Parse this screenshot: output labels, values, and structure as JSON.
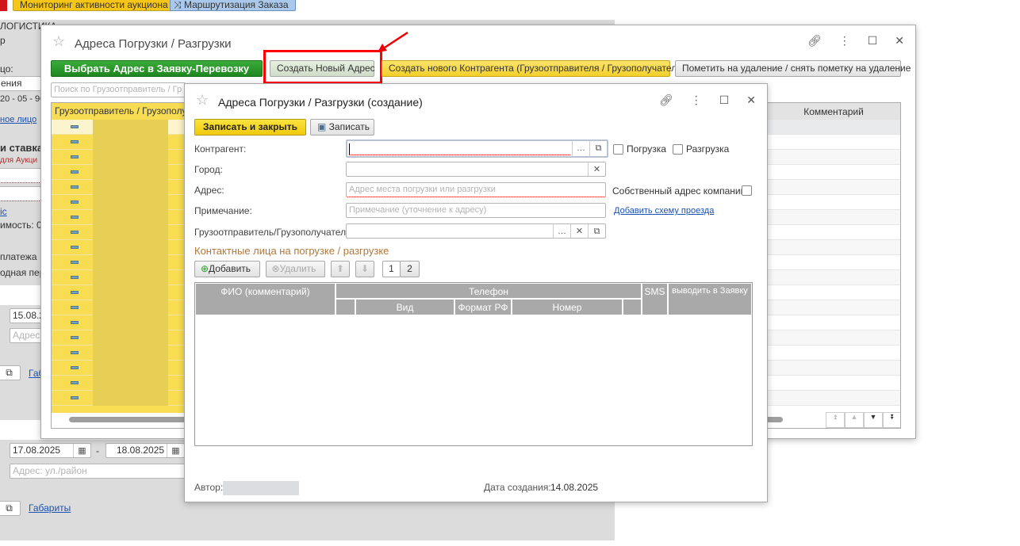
{
  "top_toolbar": {
    "monitoring": "Мониторинг активности аукциона",
    "routing": "Маршрутизация Заказа",
    "routing_icon": "shuffle-icon"
  },
  "background": {
    "section_title": "ЛОГИСТИКА",
    "line1": "р",
    "contact_label": "цо:",
    "field1": "ения",
    "phone": "20 - 05 - 90",
    "contact_link": "ное лицо",
    "rate_title": "и ставка",
    "rate_sub": "для Аукци",
    "link_ic": "ic",
    "cost": "имость: 0",
    "payment": "платежа",
    "transfer": "одная пер",
    "date1": "15.08.2",
    "addr1_placeholder": "Адрес:",
    "gab1": "Габ",
    "date_from": "17.08.2025",
    "date_sep": "-",
    "date_to": "18.08.2025",
    "addr2_placeholder": "Адрес: ул./район",
    "gab2": "Габариты"
  },
  "list_window": {
    "title": "Адреса Погрузки / Разгрузки",
    "buttons": {
      "select": "Выбрать Адрес в Заявку-Перевозку",
      "create": "Создать Новый Адрес",
      "create_contractor": "Создать нового Контрагента (Грузоотправителя / Грузополучателя)",
      "mark_delete": "Пометить на удаление / снять пометку на удаление"
    },
    "search_placeholder": "Поиск по Грузоотправитель / Гр",
    "columns": {
      "shipper": "Грузоотправитель / Грузополуч",
      "comment": "Комментарий"
    }
  },
  "create_dialog": {
    "title": "Адреса Погрузки / Разгрузки (создание)",
    "save_close": "Записать и закрыть",
    "save": "Записать",
    "labels": {
      "contractor": "Контрагент:",
      "city": "Город:",
      "address": "Адрес:",
      "note": "Примечание:",
      "shipper": "Грузоотправитель/Грузополучатель:"
    },
    "address_placeholder": "Адрес места погрузки или разгрузки",
    "note_placeholder": "Примечание (уточнение к адресу)",
    "checkboxes": {
      "loading": "Погрузка",
      "unloading": "Разгрузка",
      "own_address": "Собственный адрес компании:"
    },
    "route_link": "Добавить схему проезда",
    "contacts_title": "Контактные лица на погрузке / разгрузке",
    "add": "Добавить",
    "delete": "Удалить",
    "page1": "1",
    "page2": "2",
    "table": {
      "fio": "ФИО (комментарий)",
      "phone": "Телефон",
      "kind": "Вид",
      "format": "Формат РФ",
      "number": "Номер",
      "sms": "SMS",
      "show": "выводить в Заявку"
    },
    "author_label": "Автор:",
    "created_label": "Дата создания:",
    "created_date": "14.08.2025"
  },
  "colors": {
    "accent_yellow": "#f5d31c",
    "green": "#2a9a2a",
    "highlight": "#ff0000"
  }
}
